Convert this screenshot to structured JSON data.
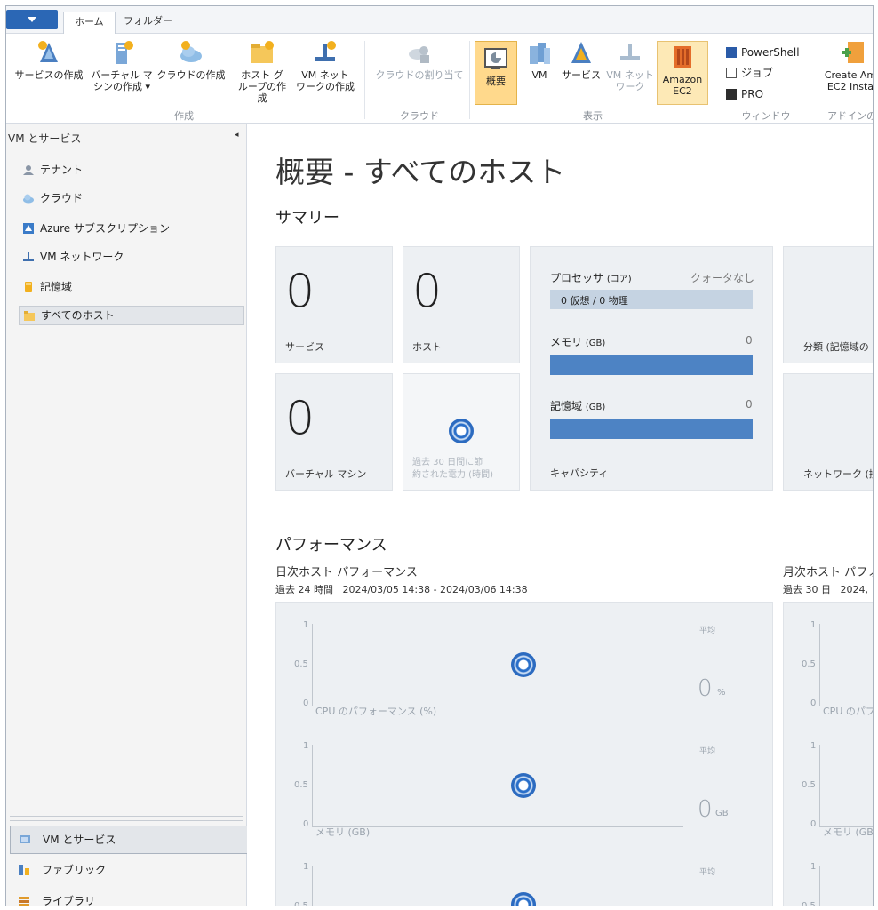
{
  "tabs": {
    "home": "ホーム",
    "folder": "フォルダー"
  },
  "ribbon": {
    "create_service": "サービスの作成",
    "create_vm_1": "バーチャル マ",
    "create_vm_2": "シンの作成 ▾",
    "create_cloud": "クラウドの作成",
    "create_hostgroup_1": "ホスト グ",
    "create_hostgroup_2": "ループの作成",
    "create_vmnet_1": "VM ネット",
    "create_vmnet_2": "ワークの作成",
    "group_create": "作成",
    "assign_cloud": "クラウドの割り当て",
    "group_cloud": "クラウド",
    "view_overview": "概要",
    "view_vm": "VM",
    "view_service": "サービス",
    "view_vmnet_1": "VM ネット",
    "view_vmnet_2": "ワーク",
    "view_amazon_1": "Amazon",
    "view_amazon_2": "EC2",
    "group_view": "表示",
    "powershell": "PowerShell",
    "jobs": "ジョブ",
    "pro": "PRO",
    "group_window": "ウィンドウ",
    "create_ec2_1": "Create Am",
    "create_ec2_2": "EC2 Insta",
    "group_addin": "アドインの"
  },
  "nav": {
    "header": "VM とサービス",
    "items": [
      "テナント",
      "クラウド",
      "Azure サブスクリプション",
      "VM ネットワーク",
      "記憶域",
      "すべてのホスト"
    ],
    "workspaces": [
      "VM とサービス",
      "ファブリック",
      "ライブラリ"
    ]
  },
  "main": {
    "title": "概要 - すべてのホスト",
    "summary_heading": "サマリー",
    "services_count": "0",
    "services_label": "サービス",
    "hosts_count": "0",
    "hosts_label": "ホスト",
    "vms_count": "0",
    "vms_label": "バーチャル マシン",
    "power_label_1": "過去 30 日間に節",
    "power_label_2": "約された電力 (時間)",
    "capacity": {
      "processor": "プロセッサ",
      "processor_unit": "(コア)",
      "quota": "クォータなし",
      "processor_bar": "0 仮想 / 0 物理",
      "memory": "メモリ",
      "memory_unit": "(GB)",
      "memory_value": "0",
      "storage": "記憶域",
      "storage_unit": "(GB)",
      "storage_value": "0",
      "label": "キャパシティ"
    },
    "classification_label": "分類 (記憶域の",
    "network_label": "ネットワーク (接",
    "performance_heading": "パフォーマンス",
    "daily_title": "日次ホスト パフォーマンス",
    "daily_range": "過去 24 時間   2024/03/05 14:38 - 2024/03/06 14:38",
    "monthly_title": "月次ホスト パフォ",
    "monthly_range": "過去 30 日   2024,",
    "charts": [
      {
        "label": "CPU のパフォーマンス (%)",
        "avg_label": "平均",
        "value": "0",
        "unit": "%"
      },
      {
        "label": "メモリ (GB)",
        "avg_label": "平均",
        "value": "0",
        "unit": "GB"
      },
      {
        "label": "",
        "avg_label": "平均",
        "value": "",
        "unit": ""
      }
    ],
    "monthly_charts": [
      "CPU のパフ",
      "メモリ (GB)",
      ""
    ],
    "tick_1": "1",
    "tick_05": "0.5",
    "tick_0": "0"
  }
}
